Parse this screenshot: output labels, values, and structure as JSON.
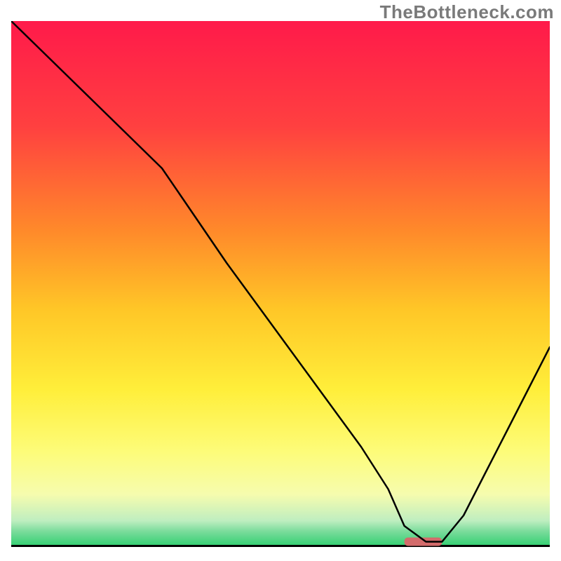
{
  "watermark": "TheBottleneck.com",
  "chart_data": {
    "type": "line",
    "title": "",
    "xlabel": "",
    "ylabel": "",
    "xlim": [
      0,
      100
    ],
    "ylim": [
      0,
      100
    ],
    "grid": false,
    "legend": false,
    "annotations": [
      {
        "name": "optimum-marker",
        "x_range": [
          73,
          80
        ],
        "y": 1,
        "color": "#d36b6b"
      }
    ],
    "background_gradient": {
      "stops": [
        {
          "offset": 0.0,
          "color": "#ff1a4a"
        },
        {
          "offset": 0.2,
          "color": "#ff4040"
        },
        {
          "offset": 0.4,
          "color": "#ff8a2a"
        },
        {
          "offset": 0.55,
          "color": "#ffc727"
        },
        {
          "offset": 0.7,
          "color": "#ffee3a"
        },
        {
          "offset": 0.82,
          "color": "#fdfc7a"
        },
        {
          "offset": 0.9,
          "color": "#f6fcae"
        },
        {
          "offset": 0.95,
          "color": "#bfeec0"
        },
        {
          "offset": 0.97,
          "color": "#7bdc9c"
        },
        {
          "offset": 1.0,
          "color": "#2ecf6f"
        }
      ]
    },
    "series": [
      {
        "name": "bottleneck-curve",
        "color": "#000000",
        "width": 2.5,
        "x": [
          0,
          5,
          10,
          15,
          20,
          24,
          28,
          32,
          36,
          40,
          45,
          50,
          55,
          60,
          65,
          70,
          73,
          77,
          80,
          84,
          88,
          92,
          96,
          100
        ],
        "y": [
          100,
          95,
          90,
          85,
          80,
          76,
          72,
          66,
          60,
          54,
          47,
          40,
          33,
          26,
          19,
          11,
          4,
          1,
          1,
          6,
          14,
          22,
          30,
          38
        ]
      }
    ]
  }
}
